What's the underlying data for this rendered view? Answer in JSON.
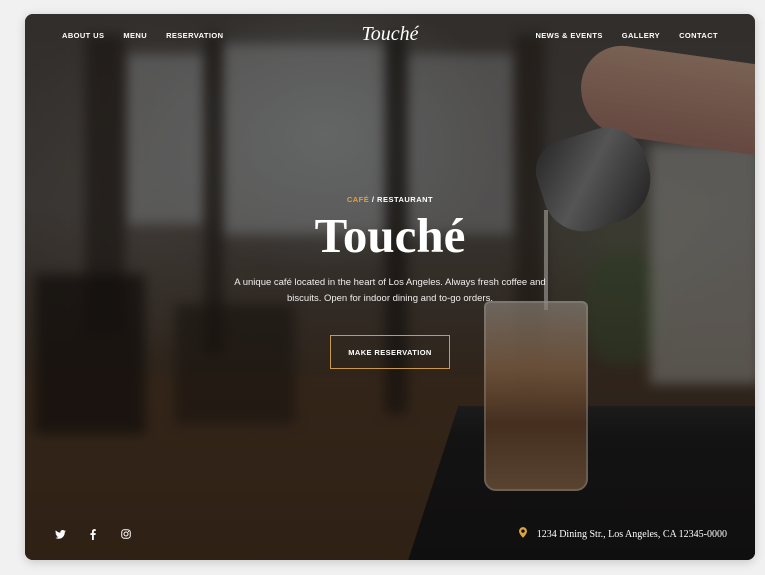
{
  "nav": {
    "brand": "Touché",
    "left_items": [
      {
        "label": "ABOUT US"
      },
      {
        "label": "MENU"
      },
      {
        "label": "RESERVATION"
      }
    ],
    "right_items": [
      {
        "label": "NEWS & EVENTS"
      },
      {
        "label": "GALLERY"
      },
      {
        "label": "CONTACT"
      }
    ]
  },
  "hero": {
    "eyebrow_accent": "CAFÉ",
    "eyebrow_separator": " / ",
    "eyebrow_rest": "RESTAURANT",
    "title": "Touché",
    "description": "A unique café located in the heart of Los Angeles. Always fresh coffee and biscuits. Open for indoor dining and to-go orders.",
    "cta_label": "MAKE RESERVATION"
  },
  "footer": {
    "social_icons": [
      "twitter-icon",
      "facebook-icon",
      "instagram-icon"
    ],
    "address": "1234 Dining Str., Los Angeles, CA 12345-0000"
  },
  "colors": {
    "accent": "#d9a441",
    "text": "#ffffff",
    "button_border": "#c99a4c"
  }
}
